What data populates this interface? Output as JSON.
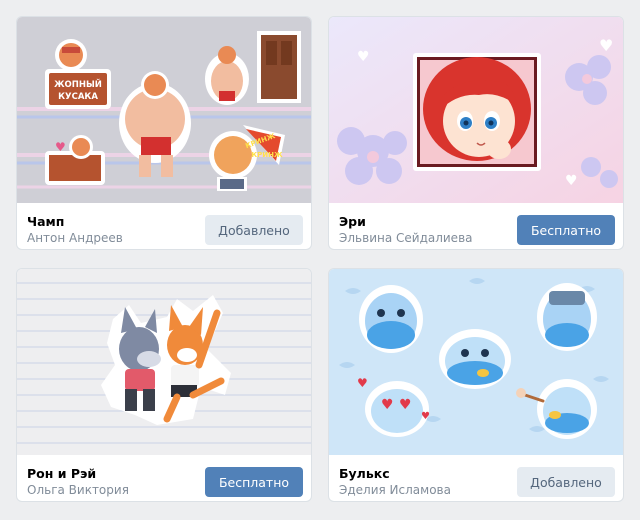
{
  "packs": [
    {
      "title": "Чамп",
      "author": "Антон Андреев",
      "button": "Добавлено",
      "state": "added",
      "art_text": {
        "sign_line1": "ЖОПНЫЙ",
        "sign_line2": "КУСАКА",
        "fan_line1": "КРИНЖ",
        "fan_line2": "КРИНЖ"
      }
    },
    {
      "title": "Эри",
      "author": "Эльвина Сейдалиева",
      "button": "Бесплатно",
      "state": "free"
    },
    {
      "title": "Рон и Рэй",
      "author": "Ольга Виктория",
      "button": "Бесплатно",
      "state": "free"
    },
    {
      "title": "Булькс",
      "author": "Эделия Исламова",
      "button": "Добавлено",
      "state": "added"
    }
  ],
  "colors": {
    "page_bg": "#edeef0",
    "primary_button": "#5181b8",
    "secondary_button": "#e5ebf1",
    "secondary_text": "#818c99"
  }
}
